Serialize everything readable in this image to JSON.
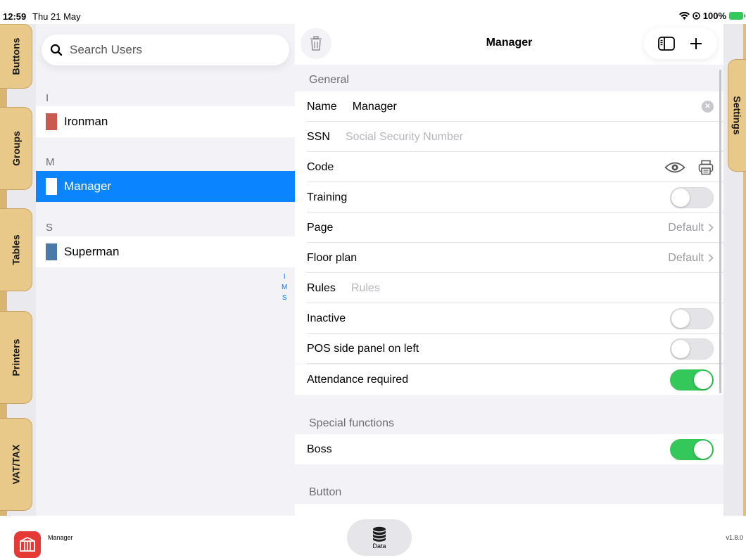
{
  "status": {
    "time": "12:59",
    "date": "Thu 21 May",
    "battery": "100%"
  },
  "tabs": [
    {
      "label": "Buttons"
    },
    {
      "label": "Groups"
    },
    {
      "label": "Tables"
    },
    {
      "label": "Printers"
    },
    {
      "label": "VAT/TAX"
    }
  ],
  "settings_tab": {
    "label": "Settings"
  },
  "search": {
    "placeholder": "Search Users"
  },
  "sections": [
    {
      "letter": "I",
      "users": [
        {
          "name": "Ironman",
          "color": "#c85a4e"
        }
      ]
    },
    {
      "letter": "M",
      "users": [
        {
          "name": "Manager",
          "color": "#ffffff",
          "selected": true
        }
      ]
    },
    {
      "letter": "S",
      "users": [
        {
          "name": "Superman",
          "color": "#4a7aa8"
        }
      ]
    }
  ],
  "index_letters": [
    "I",
    "M",
    "S"
  ],
  "main": {
    "title": "Manager",
    "general_header": "General",
    "name_label": "Name",
    "name_value": "Manager",
    "ssn_label": "SSN",
    "ssn_placeholder": "Social Security Number",
    "code_label": "Code",
    "training_label": "Training",
    "training_on": false,
    "page_label": "Page",
    "page_value": "Default",
    "floor_label": "Floor plan",
    "floor_value": "Default",
    "rules_label": "Rules",
    "rules_placeholder": "Rules",
    "inactive_label": "Inactive",
    "inactive_on": false,
    "pos_label": "POS side panel on left",
    "pos_on": false,
    "attendance_label": "Attendance required",
    "attendance_on": true,
    "special_header": "Special functions",
    "boss_label": "Boss",
    "boss_on": true,
    "button_header": "Button"
  },
  "bottom": {
    "app_name": "Manager",
    "data_label": "Data",
    "version": "v1.8.0"
  },
  "colors": {
    "accent": "#0a84ff",
    "toggle_on": "#34c759",
    "tab": "#e9c98a"
  }
}
